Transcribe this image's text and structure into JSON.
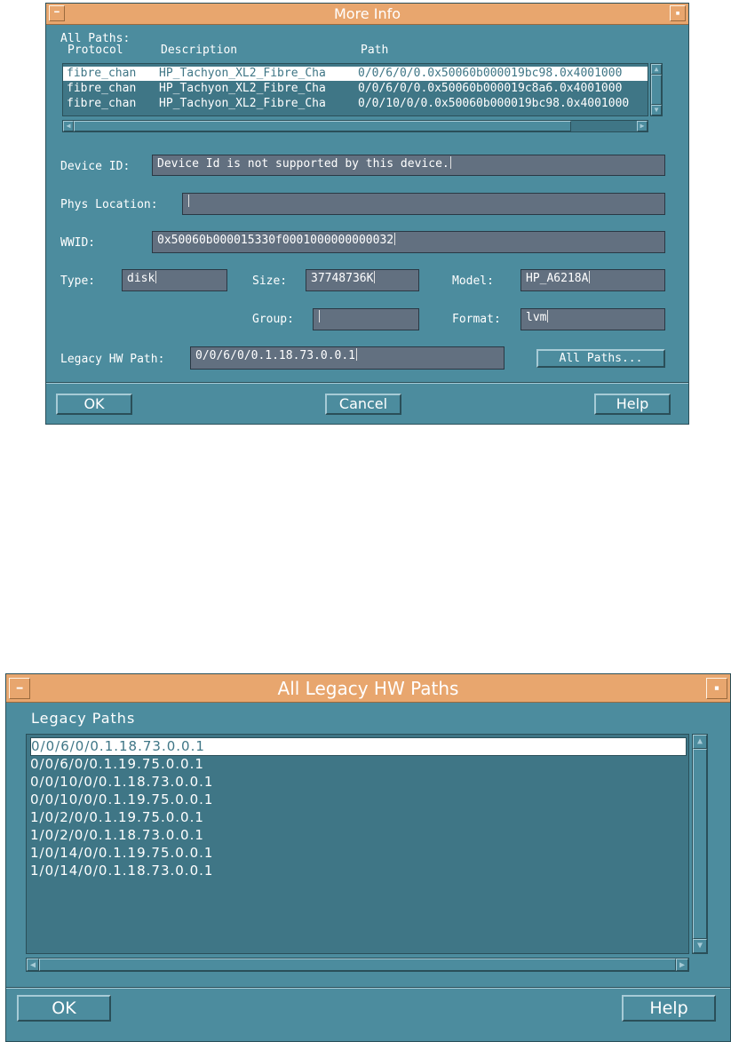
{
  "more_info": {
    "title": "More Info",
    "title_icons": {
      "left": "minimize-icon",
      "right": "maximize-icon"
    },
    "all_paths_label": "All Paths:",
    "columns": [
      "Protocol",
      "Description",
      "Path"
    ],
    "paths": [
      {
        "protocol": "fibre_chan",
        "description": "HP_Tachyon_XL2_Fibre_Cha",
        "path": "0/0/6/0/0.0x50060b000019bc98.0x4001000"
      },
      {
        "protocol": "fibre_chan",
        "description": "HP_Tachyon_XL2_Fibre_Cha",
        "path": "0/0/6/0/0.0x50060b000019c8a6.0x4001000"
      },
      {
        "protocol": "fibre_chan",
        "description": "HP_Tachyon_XL2_Fibre_Cha",
        "path": "0/0/10/0/0.0x50060b000019bc98.0x4001000"
      }
    ],
    "device_id": {
      "label": "Device ID:",
      "value": "Device Id is not supported by this device."
    },
    "phys_location": {
      "label": "Phys Location:",
      "value": ""
    },
    "wwid": {
      "label": "WWID:",
      "value": "0x50060b000015330f0001000000000032"
    },
    "type": {
      "label": "Type:",
      "value": "disk"
    },
    "size": {
      "label": "Size:",
      "value": "37748736K"
    },
    "model": {
      "label": "Model:",
      "value": "HP_A6218A"
    },
    "group": {
      "label": "Group:",
      "value": ""
    },
    "format": {
      "label": "Format:",
      "value": "lvm"
    },
    "legacy_hw_path": {
      "label": "Legacy HW Path:",
      "value": "0/0/6/0/0.1.18.73.0.0.1"
    },
    "all_paths_button": "All Paths...",
    "ok_button": "OK",
    "cancel_button": "Cancel",
    "help_button": "Help"
  },
  "legacy_paths": {
    "title": "All Legacy HW Paths",
    "title_icons": {
      "left": "minimize-icon",
      "right": "maximize-icon"
    },
    "heading": "Legacy Paths",
    "items": [
      "0/0/6/0/0.1.18.73.0.0.1",
      "0/0/6/0/0.1.19.75.0.0.1",
      "0/0/10/0/0.1.18.73.0.0.1",
      "0/0/10/0/0.1.19.75.0.0.1",
      "1/0/2/0/0.1.19.75.0.0.1",
      "1/0/2/0/0.1.18.73.0.0.1",
      "1/0/14/0/0.1.19.75.0.0.1",
      "1/0/14/0/0.1.18.73.0.0.1"
    ],
    "ok_button": "OK",
    "help_button": "Help"
  },
  "colors": {
    "window_bg": "#4c8c9e",
    "titlebar": "#e8a66e",
    "field_bg": "#627080",
    "list_bg": "#3f7686"
  }
}
